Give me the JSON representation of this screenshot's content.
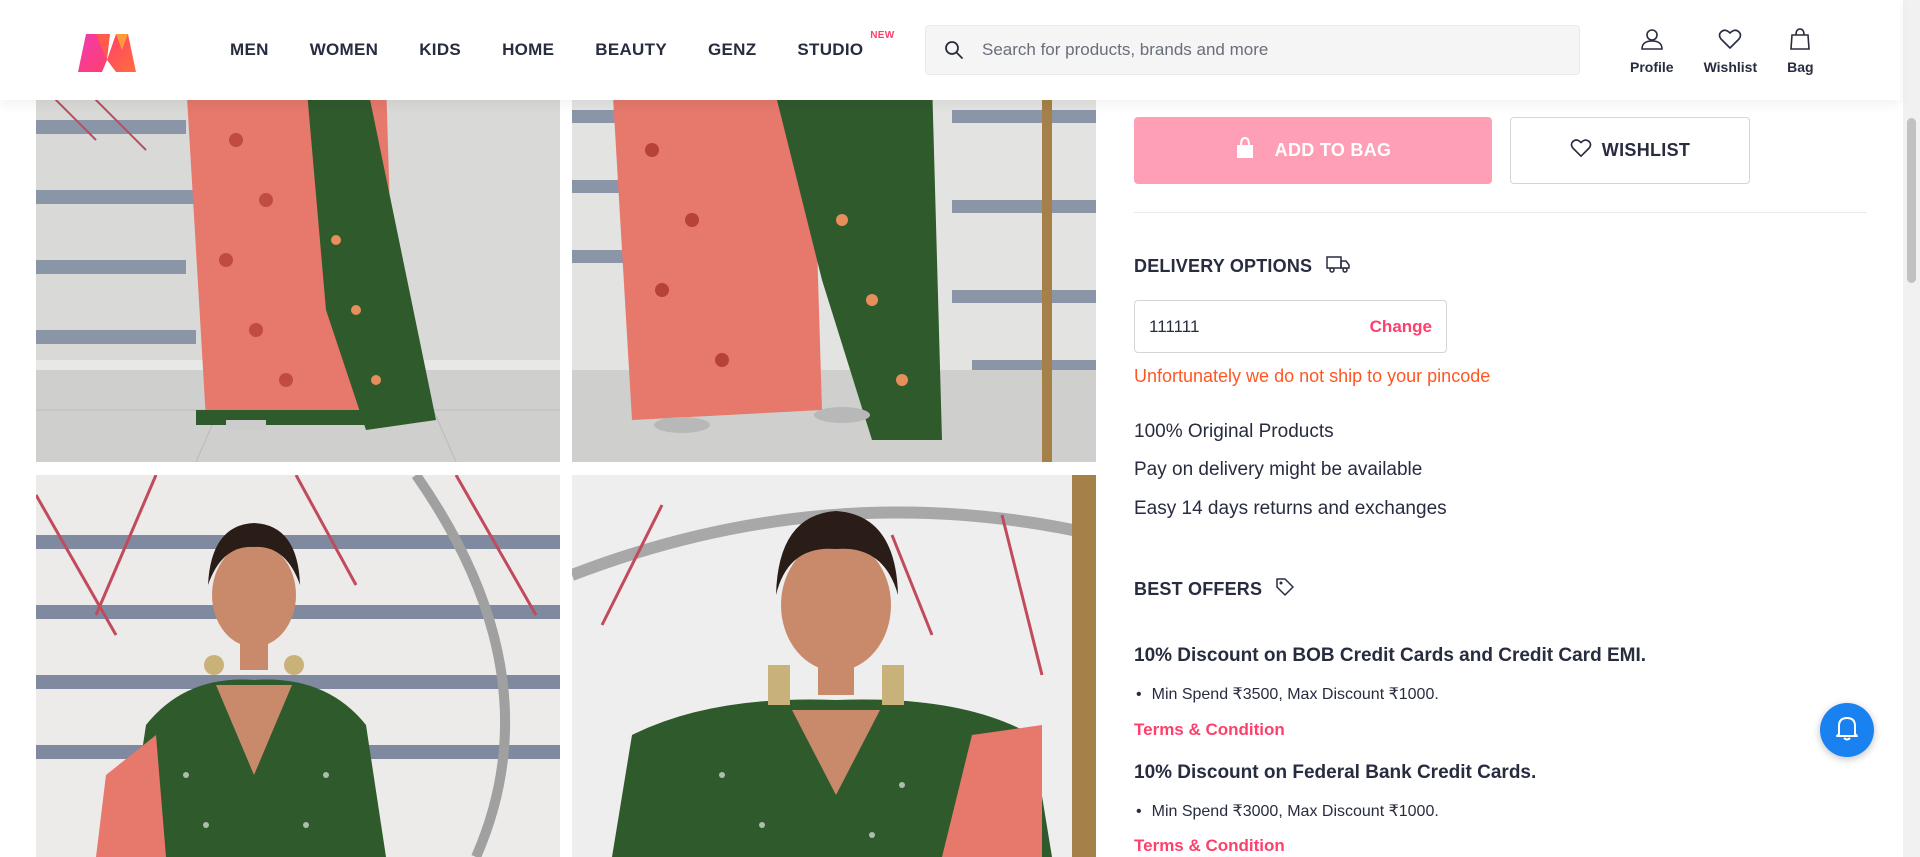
{
  "brand": {
    "accent": "#ff3f6c",
    "bag_button_color": "#ff9fb5",
    "bell_color": "#1a82f0",
    "error_color": "#ff5722"
  },
  "nav": {
    "items": [
      {
        "label": "MEN"
      },
      {
        "label": "WOMEN"
      },
      {
        "label": "KIDS"
      },
      {
        "label": "HOME"
      },
      {
        "label": "BEAUTY"
      },
      {
        "label": "GENZ"
      },
      {
        "label": "STUDIO",
        "badge": "NEW"
      }
    ]
  },
  "search": {
    "placeholder": "Search for products, brands and more",
    "icon": "search-icon"
  },
  "header_actions": [
    {
      "label": "Profile",
      "icon": "profile-icon"
    },
    {
      "label": "Wishlist",
      "icon": "heart-icon"
    },
    {
      "label": "Bag",
      "icon": "bag-icon"
    }
  ],
  "product": {
    "add_to_bag_label": "ADD TO BAG",
    "wishlist_label": "WISHLIST"
  },
  "delivery": {
    "title": "DELIVERY OPTIONS",
    "pincode": "111111",
    "change_label": "Change",
    "error": "Unfortunately we do not ship to your pincode",
    "features": [
      "100% Original Products",
      "Pay on delivery might be available",
      "Easy 14 days returns and exchanges"
    ]
  },
  "offers": {
    "title": "BEST OFFERS",
    "items": [
      {
        "title": "10% Discount on BOB Credit Cards and Credit Card EMI.",
        "detail": "Min Spend ₹3500, Max Discount ₹1000.",
        "link": "Terms & Condition"
      },
      {
        "title": "10% Discount on Federal Bank Credit Cards.",
        "detail": "Min Spend ₹3000, Max Discount ₹1000.",
        "link": "Terms & Condition"
      }
    ]
  }
}
